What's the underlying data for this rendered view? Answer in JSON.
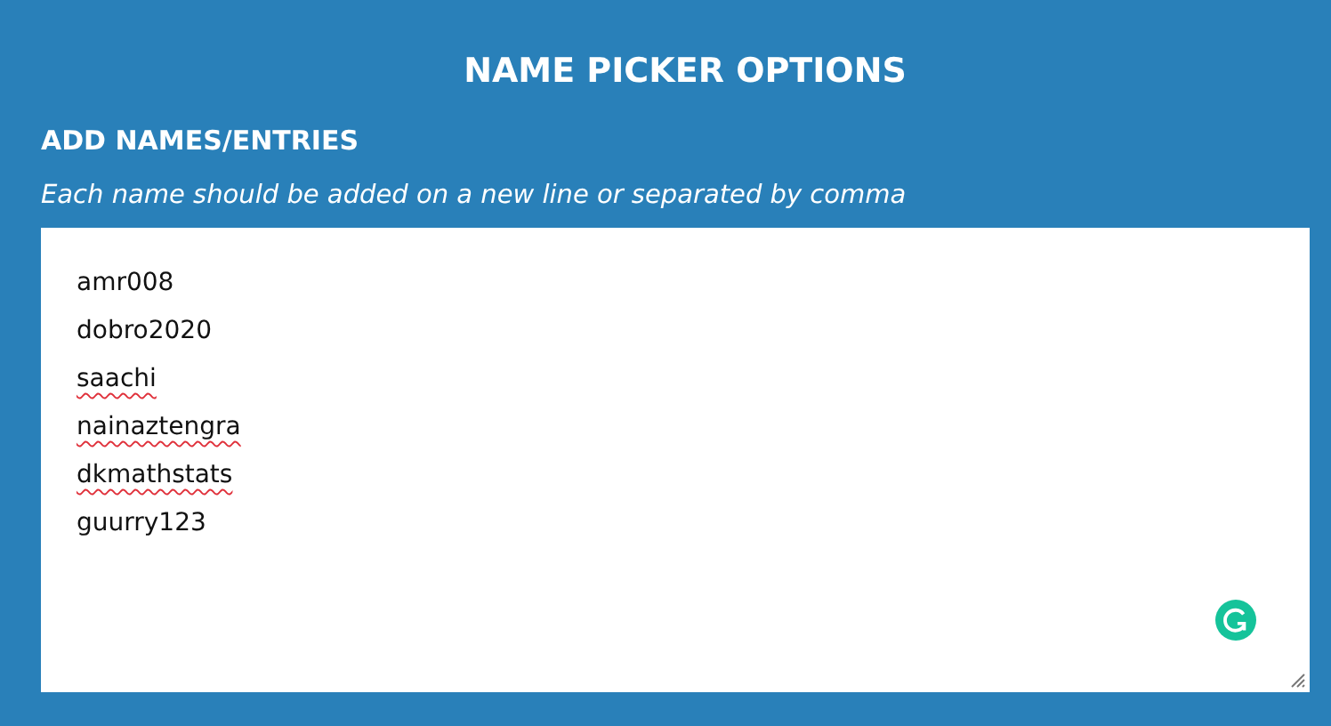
{
  "title": "NAME PICKER OPTIONS",
  "section": {
    "heading": "ADD NAMES/ENTRIES",
    "hint": "Each name should be added on a new line or separated by comma"
  },
  "entries": [
    {
      "text": "amr008",
      "misspelled": false
    },
    {
      "text": "dobro2020",
      "misspelled": false
    },
    {
      "text": "saachi",
      "misspelled": true
    },
    {
      "text": "nainaztengra",
      "misspelled": true
    },
    {
      "text": "dkmathstats",
      "misspelled": true
    },
    {
      "text": "guurry123",
      "misspelled": false
    }
  ]
}
